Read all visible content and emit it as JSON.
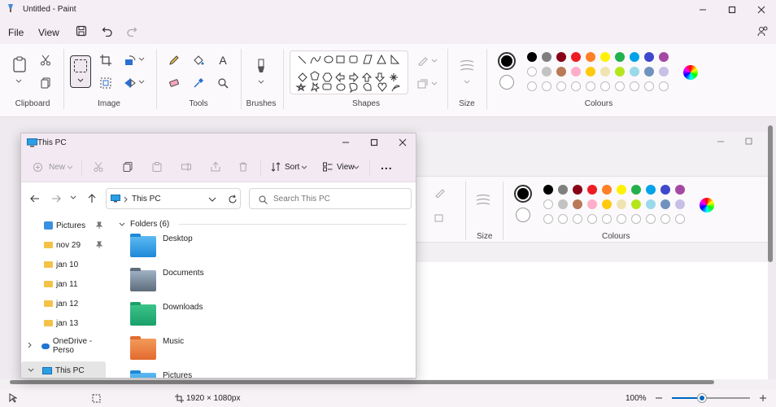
{
  "app": {
    "title": "Untitled - Paint",
    "menu": [
      "File",
      "View"
    ]
  },
  "ribbon": {
    "groups": [
      "Clipboard",
      "Image",
      "Tools",
      "Brushes",
      "Shapes",
      "Size",
      "Colours"
    ]
  },
  "colors": {
    "primary": "#000000",
    "secondary": "#ffffff",
    "palette_row1": [
      "#000000",
      "#7f7f7f",
      "#880015",
      "#ed1c24",
      "#ff7f27",
      "#fff200",
      "#22b14c",
      "#00a2e8",
      "#3f48cc",
      "#a349a4"
    ],
    "palette_row2": [
      "#ffffff",
      "#c3c3c3",
      "#b97a57",
      "#ffaec9",
      "#ffc90e",
      "#efe4b0",
      "#b5e61d",
      "#99d9ea",
      "#7092be",
      "#c8bfe7"
    ]
  },
  "statusbar": {
    "canvas_size": "1920 × 1080px",
    "zoom": "100%"
  },
  "explorer": {
    "title": "This PC",
    "toolbar": {
      "new": "New",
      "sort": "Sort",
      "view": "View",
      "more": "..."
    },
    "address": "This PC",
    "search_placeholder": "Search This PC",
    "nav": [
      {
        "label": "Pictures",
        "pinned": true
      },
      {
        "label": "nov 29",
        "pinned": true
      },
      {
        "label": "jan 10",
        "pinned": false
      },
      {
        "label": "jan 11",
        "pinned": false
      },
      {
        "label": "jan 12",
        "pinned": false
      },
      {
        "label": "jan 13",
        "pinned": false
      },
      {
        "label": "OneDrive - Perso",
        "pinned": false
      },
      {
        "label": "This PC",
        "pinned": false
      }
    ],
    "section": "Folders",
    "count": "(6)",
    "folders": [
      "Desktop",
      "Documents",
      "Downloads",
      "Music",
      "Pictures"
    ]
  },
  "background_paint": {
    "size_label": "Size",
    "colours_label": "Colours"
  }
}
